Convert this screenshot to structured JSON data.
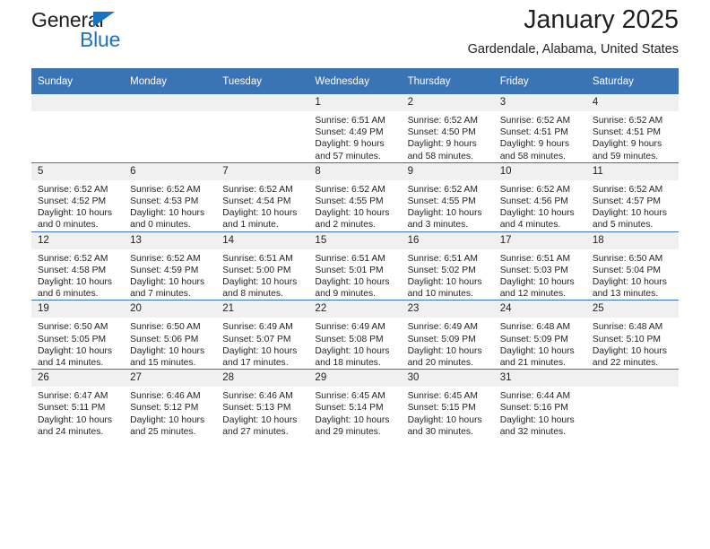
{
  "brand": {
    "line1": "General",
    "line2": "Blue",
    "triangle_color": "#1a73c1"
  },
  "header": {
    "title": "January 2025",
    "subtitle": "Gardendale, Alabama, United States"
  },
  "theme": {
    "header_blue": "#3b74b5",
    "daynum_band": "#f0f0f0",
    "text": "#231f20"
  },
  "calendar": {
    "weekday_headers": [
      "Sunday",
      "Monday",
      "Tuesday",
      "Wednesday",
      "Thursday",
      "Friday",
      "Saturday"
    ],
    "labels": {
      "sunrise": "Sunrise:",
      "sunset": "Sunset:",
      "daylight": "Daylight:"
    },
    "weeks": [
      [
        {
          "day": "",
          "empty": true
        },
        {
          "day": "",
          "empty": true
        },
        {
          "day": "",
          "empty": true
        },
        {
          "day": "1",
          "sunrise": "Sunrise: 6:51 AM",
          "sunset": "Sunset: 4:49 PM",
          "daylight_1": "Daylight: 9 hours",
          "daylight_2": "and 57 minutes."
        },
        {
          "day": "2",
          "sunrise": "Sunrise: 6:52 AM",
          "sunset": "Sunset: 4:50 PM",
          "daylight_1": "Daylight: 9 hours",
          "daylight_2": "and 58 minutes."
        },
        {
          "day": "3",
          "sunrise": "Sunrise: 6:52 AM",
          "sunset": "Sunset: 4:51 PM",
          "daylight_1": "Daylight: 9 hours",
          "daylight_2": "and 58 minutes."
        },
        {
          "day": "4",
          "sunrise": "Sunrise: 6:52 AM",
          "sunset": "Sunset: 4:51 PM",
          "daylight_1": "Daylight: 9 hours",
          "daylight_2": "and 59 minutes."
        }
      ],
      [
        {
          "day": "5",
          "sunrise": "Sunrise: 6:52 AM",
          "sunset": "Sunset: 4:52 PM",
          "daylight_1": "Daylight: 10 hours",
          "daylight_2": "and 0 minutes."
        },
        {
          "day": "6",
          "sunrise": "Sunrise: 6:52 AM",
          "sunset": "Sunset: 4:53 PM",
          "daylight_1": "Daylight: 10 hours",
          "daylight_2": "and 0 minutes."
        },
        {
          "day": "7",
          "sunrise": "Sunrise: 6:52 AM",
          "sunset": "Sunset: 4:54 PM",
          "daylight_1": "Daylight: 10 hours",
          "daylight_2": "and 1 minute."
        },
        {
          "day": "8",
          "sunrise": "Sunrise: 6:52 AM",
          "sunset": "Sunset: 4:55 PM",
          "daylight_1": "Daylight: 10 hours",
          "daylight_2": "and 2 minutes."
        },
        {
          "day": "9",
          "sunrise": "Sunrise: 6:52 AM",
          "sunset": "Sunset: 4:55 PM",
          "daylight_1": "Daylight: 10 hours",
          "daylight_2": "and 3 minutes."
        },
        {
          "day": "10",
          "sunrise": "Sunrise: 6:52 AM",
          "sunset": "Sunset: 4:56 PM",
          "daylight_1": "Daylight: 10 hours",
          "daylight_2": "and 4 minutes."
        },
        {
          "day": "11",
          "sunrise": "Sunrise: 6:52 AM",
          "sunset": "Sunset: 4:57 PM",
          "daylight_1": "Daylight: 10 hours",
          "daylight_2": "and 5 minutes."
        }
      ],
      [
        {
          "day": "12",
          "sunrise": "Sunrise: 6:52 AM",
          "sunset": "Sunset: 4:58 PM",
          "daylight_1": "Daylight: 10 hours",
          "daylight_2": "and 6 minutes."
        },
        {
          "day": "13",
          "sunrise": "Sunrise: 6:52 AM",
          "sunset": "Sunset: 4:59 PM",
          "daylight_1": "Daylight: 10 hours",
          "daylight_2": "and 7 minutes."
        },
        {
          "day": "14",
          "sunrise": "Sunrise: 6:51 AM",
          "sunset": "Sunset: 5:00 PM",
          "daylight_1": "Daylight: 10 hours",
          "daylight_2": "and 8 minutes."
        },
        {
          "day": "15",
          "sunrise": "Sunrise: 6:51 AM",
          "sunset": "Sunset: 5:01 PM",
          "daylight_1": "Daylight: 10 hours",
          "daylight_2": "and 9 minutes."
        },
        {
          "day": "16",
          "sunrise": "Sunrise: 6:51 AM",
          "sunset": "Sunset: 5:02 PM",
          "daylight_1": "Daylight: 10 hours",
          "daylight_2": "and 10 minutes."
        },
        {
          "day": "17",
          "sunrise": "Sunrise: 6:51 AM",
          "sunset": "Sunset: 5:03 PM",
          "daylight_1": "Daylight: 10 hours",
          "daylight_2": "and 12 minutes."
        },
        {
          "day": "18",
          "sunrise": "Sunrise: 6:50 AM",
          "sunset": "Sunset: 5:04 PM",
          "daylight_1": "Daylight: 10 hours",
          "daylight_2": "and 13 minutes."
        }
      ],
      [
        {
          "day": "19",
          "sunrise": "Sunrise: 6:50 AM",
          "sunset": "Sunset: 5:05 PM",
          "daylight_1": "Daylight: 10 hours",
          "daylight_2": "and 14 minutes."
        },
        {
          "day": "20",
          "sunrise": "Sunrise: 6:50 AM",
          "sunset": "Sunset: 5:06 PM",
          "daylight_1": "Daylight: 10 hours",
          "daylight_2": "and 15 minutes."
        },
        {
          "day": "21",
          "sunrise": "Sunrise: 6:49 AM",
          "sunset": "Sunset: 5:07 PM",
          "daylight_1": "Daylight: 10 hours",
          "daylight_2": "and 17 minutes."
        },
        {
          "day": "22",
          "sunrise": "Sunrise: 6:49 AM",
          "sunset": "Sunset: 5:08 PM",
          "daylight_1": "Daylight: 10 hours",
          "daylight_2": "and 18 minutes."
        },
        {
          "day": "23",
          "sunrise": "Sunrise: 6:49 AM",
          "sunset": "Sunset: 5:09 PM",
          "daylight_1": "Daylight: 10 hours",
          "daylight_2": "and 20 minutes."
        },
        {
          "day": "24",
          "sunrise": "Sunrise: 6:48 AM",
          "sunset": "Sunset: 5:09 PM",
          "daylight_1": "Daylight: 10 hours",
          "daylight_2": "and 21 minutes."
        },
        {
          "day": "25",
          "sunrise": "Sunrise: 6:48 AM",
          "sunset": "Sunset: 5:10 PM",
          "daylight_1": "Daylight: 10 hours",
          "daylight_2": "and 22 minutes."
        }
      ],
      [
        {
          "day": "26",
          "sunrise": "Sunrise: 6:47 AM",
          "sunset": "Sunset: 5:11 PM",
          "daylight_1": "Daylight: 10 hours",
          "daylight_2": "and 24 minutes."
        },
        {
          "day": "27",
          "sunrise": "Sunrise: 6:46 AM",
          "sunset": "Sunset: 5:12 PM",
          "daylight_1": "Daylight: 10 hours",
          "daylight_2": "and 25 minutes."
        },
        {
          "day": "28",
          "sunrise": "Sunrise: 6:46 AM",
          "sunset": "Sunset: 5:13 PM",
          "daylight_1": "Daylight: 10 hours",
          "daylight_2": "and 27 minutes."
        },
        {
          "day": "29",
          "sunrise": "Sunrise: 6:45 AM",
          "sunset": "Sunset: 5:14 PM",
          "daylight_1": "Daylight: 10 hours",
          "daylight_2": "and 29 minutes."
        },
        {
          "day": "30",
          "sunrise": "Sunrise: 6:45 AM",
          "sunset": "Sunset: 5:15 PM",
          "daylight_1": "Daylight: 10 hours",
          "daylight_2": "and 30 minutes."
        },
        {
          "day": "31",
          "sunrise": "Sunrise: 6:44 AM",
          "sunset": "Sunset: 5:16 PM",
          "daylight_1": "Daylight: 10 hours",
          "daylight_2": "and 32 minutes."
        },
        {
          "day": "",
          "empty": true
        }
      ]
    ]
  }
}
